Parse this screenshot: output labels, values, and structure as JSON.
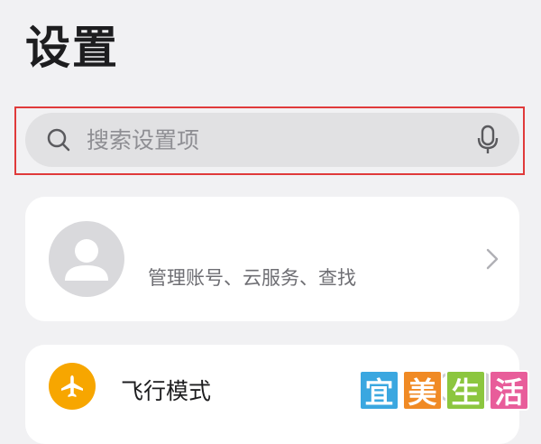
{
  "header": {
    "title": "设置"
  },
  "search": {
    "placeholder": "搜索设置项",
    "value": ""
  },
  "account": {
    "subtitle": "管理账号、云服务、查找"
  },
  "settings_items": [
    {
      "label": "飞行模式",
      "icon": "airplane-icon",
      "toggle_on": false
    }
  ],
  "watermark": {
    "chars": [
      "宜",
      "美",
      "生",
      "活"
    ]
  },
  "colors": {
    "background": "#f1f1f3",
    "search_bg": "#e1e1e3",
    "highlight_border": "#e03a3a",
    "airplane_icon_bg": "#f7a600"
  }
}
